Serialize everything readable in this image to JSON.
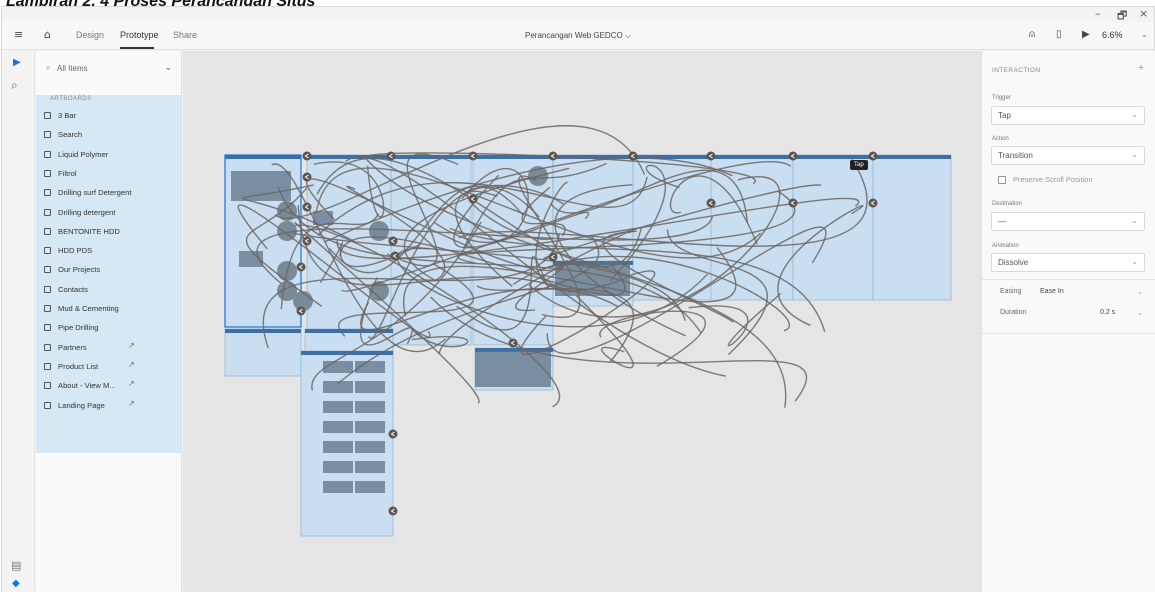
{
  "caption": "Lampiran 2. 4 Proses Perancangan Situs",
  "window": {
    "minimize": "–",
    "restore": "🗗",
    "close": "×"
  },
  "topbar": {
    "tabs": [
      {
        "label": "Design"
      },
      {
        "label": "Prototype"
      },
      {
        "label": "Share"
      }
    ],
    "doc_title": "Perancangan Web GEDCO ⌵",
    "zoom": "6.6%"
  },
  "layers": {
    "search_placeholder": "All Items",
    "section": "ARTBOARDS",
    "items": [
      {
        "label": "3 Bar"
      },
      {
        "label": "Search"
      },
      {
        "label": "Liquid Polymer"
      },
      {
        "label": "Filtrol"
      },
      {
        "label": "Drilling surf Detergent"
      },
      {
        "label": "Drilling detergent"
      },
      {
        "label": "BENTONITE HDD"
      },
      {
        "label": "HDD PDS"
      },
      {
        "label": "Our Projects"
      },
      {
        "label": "Contacts"
      },
      {
        "label": "Mud & Cementing"
      },
      {
        "label": "Pipe Drilling"
      },
      {
        "label": "Partners",
        "ext": "↗"
      },
      {
        "label": "Product List",
        "ext": "↗"
      },
      {
        "label": "About - View M...",
        "ext": "↗"
      },
      {
        "label": "Landing Page",
        "ext": "↗"
      }
    ]
  },
  "canvas": {
    "tooltip": "Tap"
  },
  "interaction": {
    "heading": "INTERACTION",
    "trigger_label": "Trigger",
    "trigger_value": "Tap",
    "action_label": "Action",
    "action_value": "Transition",
    "preserve_label": "Preserve Scroll Position",
    "destination_label": "Destination",
    "destination_value": "—",
    "animation_label": "Animation",
    "animation_value": "Dissolve",
    "easing_label": "Easing",
    "easing_value": "Ease In",
    "duration_label": "Duration",
    "duration_value": "0.2 s"
  },
  "colors": {
    "accent": "#1473e6",
    "selection": "#d6e8f6",
    "wire": "#6b6560"
  }
}
